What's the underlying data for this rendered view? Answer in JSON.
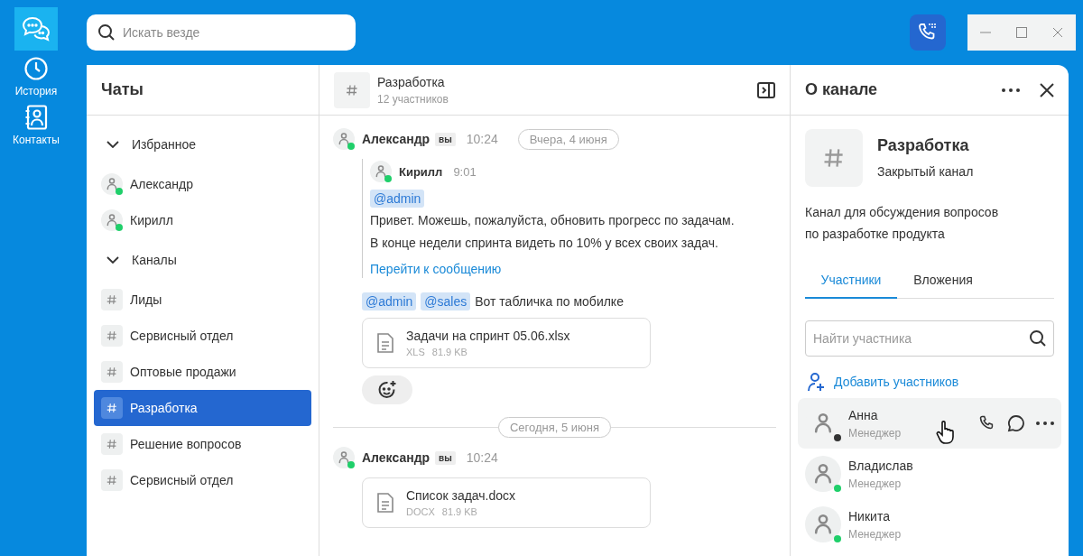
{
  "rail": {
    "items": [
      {
        "kind": "chats",
        "selected": true
      },
      {
        "kind": "history",
        "label": "История",
        "selected": false
      },
      {
        "kind": "contacts",
        "label": "Контакты",
        "selected": false
      }
    ]
  },
  "search": {
    "placeholder": "Искать везде"
  },
  "chat_list": {
    "title": "Чаты",
    "groups": [
      {
        "label": "Избранное",
        "expanded": true,
        "items": [
          {
            "kind": "person",
            "name": "Александр",
            "online": true,
            "selected": false
          },
          {
            "kind": "person",
            "name": "Кирилл",
            "online": true,
            "selected": false
          }
        ]
      },
      {
        "label": "Каналы",
        "expanded": true,
        "items": [
          {
            "kind": "channel",
            "name": "Лиды",
            "selected": false
          },
          {
            "kind": "channel",
            "name": "Сервисный отдел",
            "selected": false
          },
          {
            "kind": "channel",
            "name": "Оптовые продажи",
            "selected": false
          },
          {
            "kind": "channel",
            "name": "Разработка",
            "selected": true
          },
          {
            "kind": "channel",
            "name": "Решение вопросов",
            "selected": false
          },
          {
            "kind": "channel",
            "name": "Сервисный отдел",
            "selected": false
          }
        ]
      }
    ]
  },
  "channel": {
    "title": "Разработка",
    "members": "12 участников"
  },
  "messages": [
    {
      "kind": "message",
      "author": "Александр",
      "online": true,
      "badge": "вы",
      "time": "10:24",
      "date": "Вчера, 4 июня",
      "quote": {
        "author": "Кирилл",
        "online": true,
        "time": "9:01",
        "mentions": [
          "@admin"
        ],
        "lines": [
          "Привет. Можешь, пожалуйста, обновить прогресс по задачам.",
          "В конце недели спринта видеть по 10% у всех своих задач."
        ],
        "link": "Перейти к сообщению"
      },
      "mentions": [
        "@admin",
        "@sales"
      ],
      "text": "Вот табличка по мобилке",
      "files": [
        {
          "name": "Задачи на спринт 05.06.xlsx",
          "type": "XLS",
          "size": "81.9 KB"
        }
      ],
      "reaction_button": true
    },
    {
      "kind": "divider",
      "text": "Сегодня, 5 июня"
    },
    {
      "kind": "message",
      "author": "Александр",
      "online": true,
      "badge": "вы",
      "time": "10:24",
      "files": [
        {
          "name": "Список задач.docx",
          "type": "DOCX",
          "size": "81.9 KB"
        }
      ]
    }
  ],
  "info": {
    "title": "О канале",
    "name": "Разработка",
    "type": "Закрытый канал",
    "description": "Канал для обсуждения вопросов по разработке продукта",
    "tabs": [
      {
        "label": "Участники",
        "selected": true
      },
      {
        "label": "Вложения",
        "selected": false
      }
    ],
    "search": {
      "placeholder": "Найти участника"
    },
    "add_button": "Добавить участников",
    "members": [
      {
        "name": "Анна",
        "role": "Менеджер",
        "online": false,
        "hovered": true
      },
      {
        "name": "Владислав",
        "role": "Менеджер",
        "online": true,
        "hovered": false
      },
      {
        "name": "Никита",
        "role": "Менеджер",
        "online": true,
        "hovered": false
      }
    ]
  }
}
